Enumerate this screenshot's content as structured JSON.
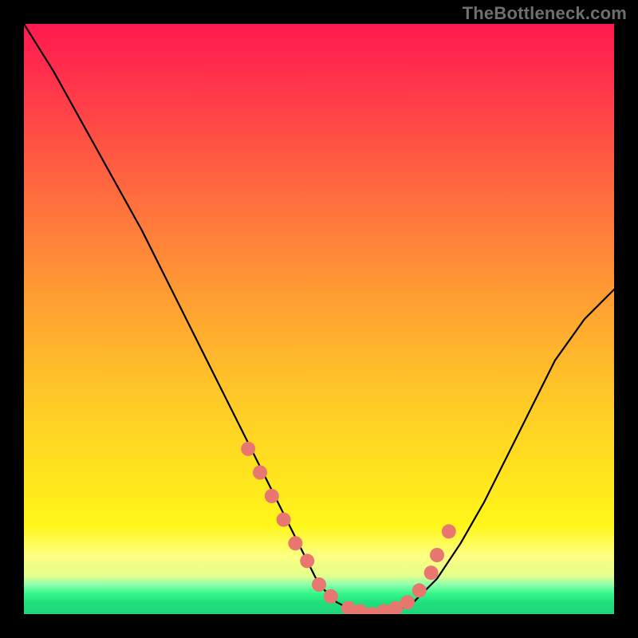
{
  "watermark": "TheBottleneck.com",
  "gradient": {
    "top": "#ff1a50",
    "mid_up": "#ff9a33",
    "mid": "#ffe31f",
    "green": "#21e07e"
  },
  "chart_data": {
    "type": "line",
    "title": "",
    "xlabel": "",
    "ylabel": "",
    "xlim": [
      0,
      100
    ],
    "ylim": [
      0,
      100
    ],
    "series": [
      {
        "name": "curve",
        "x": [
          0,
          5,
          10,
          15,
          20,
          25,
          30,
          35,
          40,
          45,
          48,
          50,
          53,
          56,
          60,
          63,
          66,
          70,
          74,
          78,
          82,
          86,
          90,
          95,
          100
        ],
        "y": [
          100,
          92,
          83,
          74,
          65,
          55,
          45,
          35,
          25,
          15,
          9,
          5,
          2,
          0.5,
          0,
          0.5,
          2,
          6,
          12,
          19,
          27,
          35,
          43,
          50,
          55
        ]
      }
    ],
    "markers": {
      "name": "highlight-dots",
      "x": [
        38,
        40,
        42,
        44,
        46,
        48,
        50,
        52,
        55,
        57,
        59,
        61,
        63,
        65,
        67,
        69,
        70,
        72
      ],
      "y": [
        28,
        24,
        20,
        16,
        12,
        9,
        5,
        3,
        1,
        0.5,
        0,
        0.5,
        1,
        2,
        4,
        7,
        10,
        14
      ]
    },
    "marker_style": {
      "color": "#e7776f",
      "radius_px": 9
    }
  }
}
